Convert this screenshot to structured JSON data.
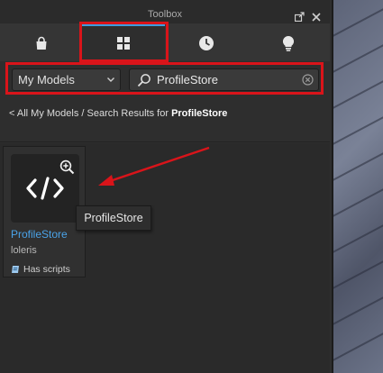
{
  "window": {
    "title": "Toolbox"
  },
  "tabs": [
    {
      "name": "marketplace",
      "icon": "bag-icon"
    },
    {
      "name": "inventory",
      "icon": "grid-icon",
      "active": true
    },
    {
      "name": "recent",
      "icon": "clock-icon"
    },
    {
      "name": "creations",
      "icon": "lightbulb-icon"
    }
  ],
  "search": {
    "category": "My Models",
    "query": "ProfileStore"
  },
  "breadcrumb": {
    "back": "< All My Models",
    "separator": " / Search Results for ",
    "term": "ProfileStore"
  },
  "results": [
    {
      "name": "ProfileStore",
      "author": "loleris",
      "badge": "Has scripts",
      "thumbnail_icon": "code-icon"
    }
  ],
  "tooltip": "ProfileStore",
  "colors": {
    "highlight": "#d9141a",
    "accent": "#3d9de0",
    "link": "#4aa3e8"
  }
}
